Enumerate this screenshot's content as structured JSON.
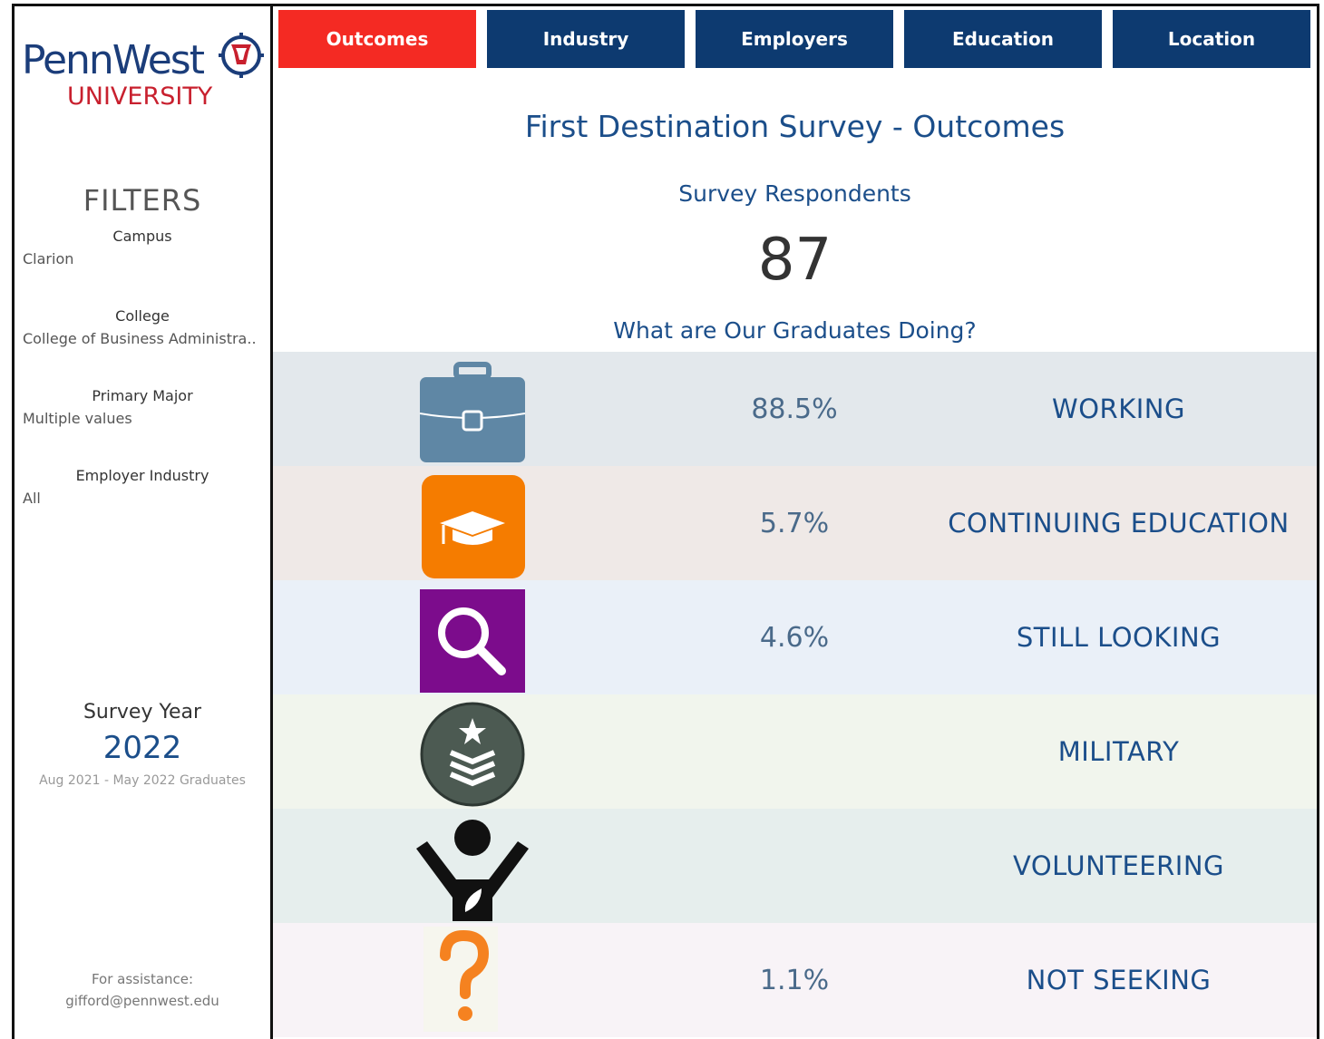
{
  "sidebar": {
    "logo": {
      "word": "PennWest",
      "sub": "UNIVERSITY"
    },
    "filters_title": "FILTERS",
    "filters": [
      {
        "label": "Campus",
        "value": "Clarion"
      },
      {
        "label": "College",
        "value": "College of Business Administra.."
      },
      {
        "label": "Primary Major",
        "value": "Multiple values"
      },
      {
        "label": "Employer Industry",
        "value": "All"
      }
    ],
    "survey_year": {
      "label": "Survey Year",
      "value": "2022",
      "sub": "Aug 2021 - May 2022 Graduates"
    },
    "assist": {
      "line1": "For assistance:",
      "line2": "gifford@pennwest.edu"
    }
  },
  "nav": [
    {
      "label": "Outcomes",
      "active": true
    },
    {
      "label": "Industry",
      "active": false
    },
    {
      "label": "Employers",
      "active": false
    },
    {
      "label": "Education",
      "active": false
    },
    {
      "label": "Location",
      "active": false
    }
  ],
  "main": {
    "title": "First Destination Survey - Outcomes",
    "respondents_label": "Survey Respondents",
    "respondents_value": "87",
    "doing_label": "What are Our Graduates Doing?"
  },
  "outcomes": [
    {
      "label": "WORKING",
      "pct": "88.5%",
      "icon": "briefcase-icon",
      "bg": "#e3e8ec"
    },
    {
      "label": "CONTINUING EDUCATION",
      "pct": "5.7%",
      "icon": "graduation-cap-icon",
      "bg": "#efe9e7"
    },
    {
      "label": "STILL LOOKING",
      "pct": "4.6%",
      "icon": "magnifier-icon",
      "bg": "#eaf0f8"
    },
    {
      "label": "MILITARY",
      "pct": "",
      "icon": "military-rank-icon",
      "bg": "#f1f5ed"
    },
    {
      "label": "VOLUNTEERING",
      "pct": "",
      "icon": "volunteer-icon",
      "bg": "#e6eeed"
    },
    {
      "label": "NOT SEEKING",
      "pct": "1.1%",
      "icon": "question-mark-icon",
      "bg": "#f8f3f7"
    }
  ],
  "colors": {
    "nav_active": "#f42a23",
    "nav_inactive": "#0d3a70",
    "heading_blue": "#1b4e8a",
    "brand_red": "#c8202e"
  }
}
